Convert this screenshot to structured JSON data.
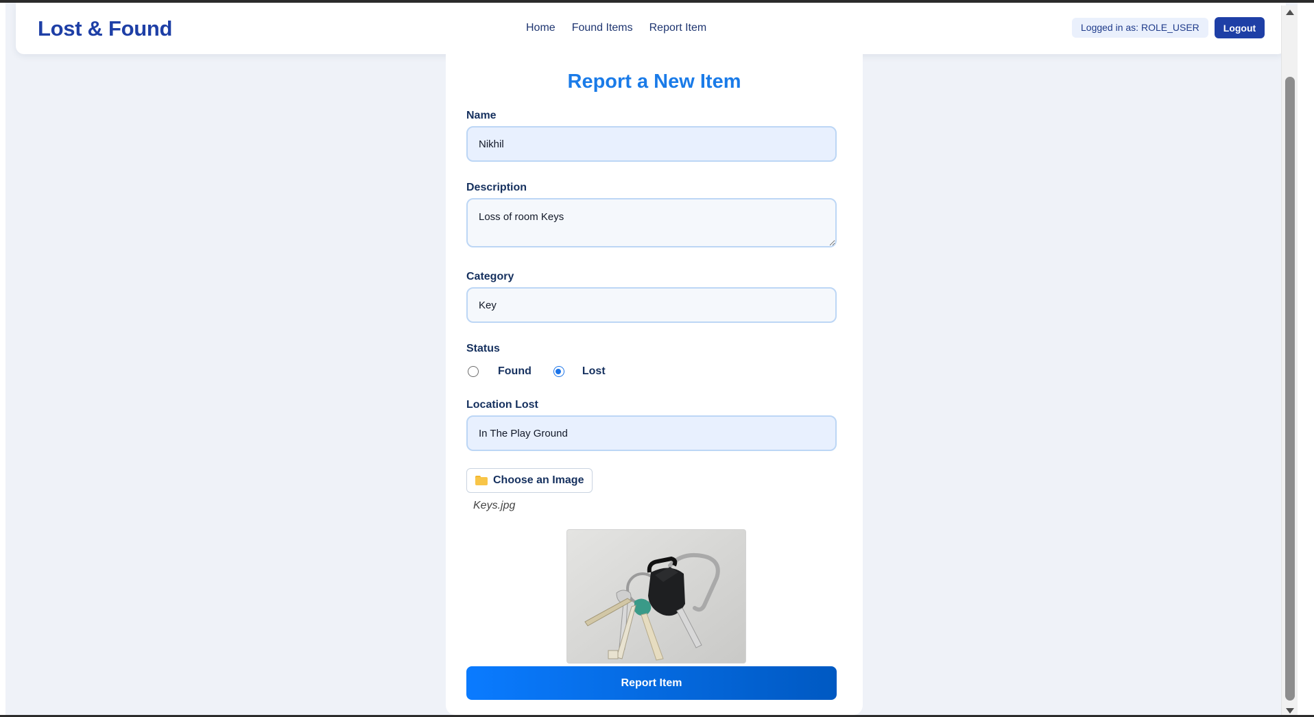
{
  "header": {
    "brand": "Lost & Found",
    "nav": [
      "Home",
      "Found Items",
      "Report Item"
    ],
    "role_badge": "Logged in as: ROLE_USER",
    "logout_label": "Logout"
  },
  "form": {
    "title": "Report a New Item",
    "name": {
      "label": "Name",
      "value": "Nikhil"
    },
    "description": {
      "label": "Description",
      "value": "Loss of room Keys"
    },
    "category": {
      "label": "Category",
      "value": "Key"
    },
    "status": {
      "label": "Status",
      "options": [
        "Found",
        "Lost"
      ],
      "selected": "Lost"
    },
    "location": {
      "label": "Location Lost",
      "value": "In The Play Ground"
    },
    "file_button_label": "Choose an Image",
    "file_name": "Keys.jpg",
    "submit_label": "Report Item"
  },
  "colors": {
    "brand": "#1e3fa6",
    "title": "#1a7be8",
    "submit_start": "#0a7bff",
    "submit_end": "#0059c2"
  },
  "icons": {
    "file_button": "folder-icon",
    "preview": "keys-photo"
  }
}
